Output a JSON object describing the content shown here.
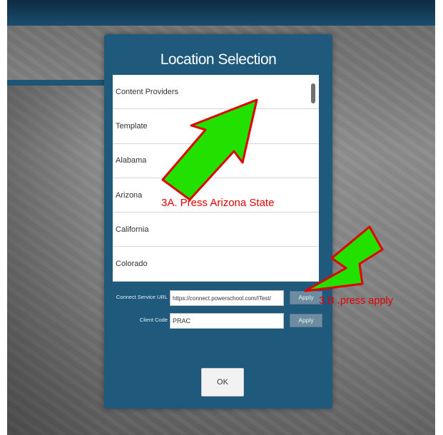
{
  "dialog": {
    "title": "Location Selection",
    "locations": [
      "Content Providers",
      "Template",
      "Alabama",
      "Arizona",
      "California",
      "Colorado"
    ],
    "connect_service": {
      "label": "Connect Service URL",
      "value": "https://connect.powerschool.com/ITest/",
      "apply_label": "Apply"
    },
    "client_code": {
      "label": "Client Code",
      "value": "PRAC",
      "apply_label": "Apply"
    },
    "ok_label": "OK"
  },
  "annotations": {
    "step_a": "3A. Press Arizona State",
    "step_b": "3.B .press apply"
  },
  "colors": {
    "dialog_bg": "#1f5a7c",
    "arrow_fill": "#22e000",
    "arrow_outline": "#e00000",
    "annotation_text": "#e00000"
  }
}
